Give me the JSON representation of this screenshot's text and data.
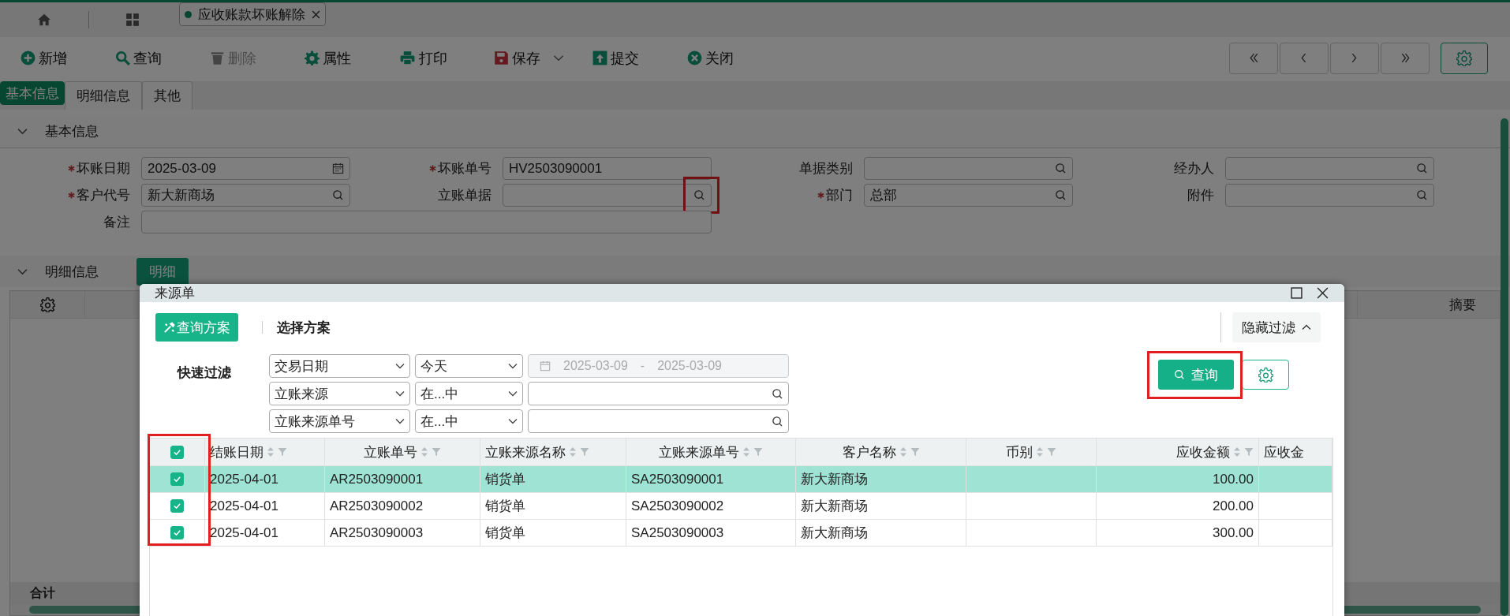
{
  "doc_tab": {
    "label": "应收账款坏账解除",
    "selected": true
  },
  "toolbar": [
    {
      "label": "新增",
      "kind": "plus",
      "disabled": false
    },
    {
      "label": "查询",
      "kind": "search",
      "disabled": false
    },
    {
      "label": "删除",
      "kind": "trash",
      "disabled": true
    },
    {
      "label": "属性",
      "kind": "gear",
      "disabled": false
    },
    {
      "label": "打印",
      "kind": "printer",
      "disabled": false
    },
    {
      "label": "保存",
      "kind": "save",
      "disabled": false
    },
    {
      "label": "提交",
      "kind": "upload",
      "disabled": false
    },
    {
      "label": "关闭",
      "kind": "close",
      "disabled": false
    }
  ],
  "form_tabs": [
    {
      "label": "基本信息",
      "selected": true
    },
    {
      "label": "明细信息",
      "selected": false
    },
    {
      "label": "其他",
      "selected": false
    }
  ],
  "basic_section": {
    "title": "基本信息",
    "expanded": true,
    "fields": [
      {
        "label": "坏账日期",
        "required": true,
        "value": "2025-03-09",
        "kind": "calendar"
      },
      {
        "label": "坏账单号",
        "required": true,
        "value": "HV2503090001",
        "kind": "plain"
      },
      {
        "label": "单据类别",
        "required": false,
        "kind": "search"
      },
      {
        "label": "经办人",
        "required": false,
        "kind": "search"
      },
      {
        "label": "客户代号",
        "required": true,
        "value": "新大新商场",
        "kind": "search"
      },
      {
        "label": "立账单据",
        "required": false,
        "kind": "search",
        "highlighted": true
      },
      {
        "label": "部门",
        "required": true,
        "value": "总部",
        "kind": "search"
      },
      {
        "label": "附件",
        "required": false,
        "kind": "search"
      },
      {
        "label": "备注",
        "required": false,
        "kind": "wide"
      }
    ]
  },
  "detail_section": {
    "title": "明细信息",
    "expanded": true,
    "button": "明细",
    "last_column": "摘要",
    "total_label": "合计"
  },
  "dialog": {
    "title": "来源单",
    "scheme_button": "查询方案",
    "scheme_label": "选择方案",
    "filter_toggle": {
      "label": "隐藏过滤",
      "expanded": true
    },
    "quick_filter_label": "快速过滤",
    "filters": [
      {
        "field": "交易日期",
        "operator": "今天",
        "kind": "date-range",
        "from": "2025-03-09",
        "separator": "-",
        "to": "2025-03-09"
      },
      {
        "field": "立账来源",
        "operator": "在...中",
        "kind": "search"
      },
      {
        "field": "立账来源单号",
        "operator": "在...中",
        "kind": "search"
      }
    ],
    "query_button": {
      "label": "查询",
      "highlighted": true
    },
    "table": {
      "all_checked": true,
      "checkbox_highlighted": true,
      "columns": [
        {
          "label": "结账日期",
          "kind": "sortable"
        },
        {
          "label": "立账单号",
          "kind": "sortable"
        },
        {
          "label": "立账来源名称",
          "kind": "sortable"
        },
        {
          "label": "立账来源单号",
          "kind": "sortable"
        },
        {
          "label": "客户名称",
          "kind": "sortable"
        },
        {
          "label": "币别",
          "kind": "sortable"
        },
        {
          "label": "应收金额",
          "kind": "sortable"
        },
        {
          "label": "应收金",
          "kind": "plain"
        }
      ],
      "rows": [
        {
          "checked": true,
          "selected": true,
          "cells": [
            "2025-04-01",
            "AR2503090001",
            "销货单",
            "SA2503090001",
            "新大新商场",
            "",
            "100.00",
            ""
          ]
        },
        {
          "checked": true,
          "selected": false,
          "cells": [
            "2025-04-01",
            "AR2503090002",
            "销货单",
            "SA2503090002",
            "新大新商场",
            "",
            "200.00",
            ""
          ]
        },
        {
          "checked": true,
          "selected": false,
          "cells": [
            "2025-04-01",
            "AR2503090003",
            "销货单",
            "SA2503090003",
            "新大新商场",
            "",
            "300.00",
            ""
          ]
        }
      ]
    }
  }
}
